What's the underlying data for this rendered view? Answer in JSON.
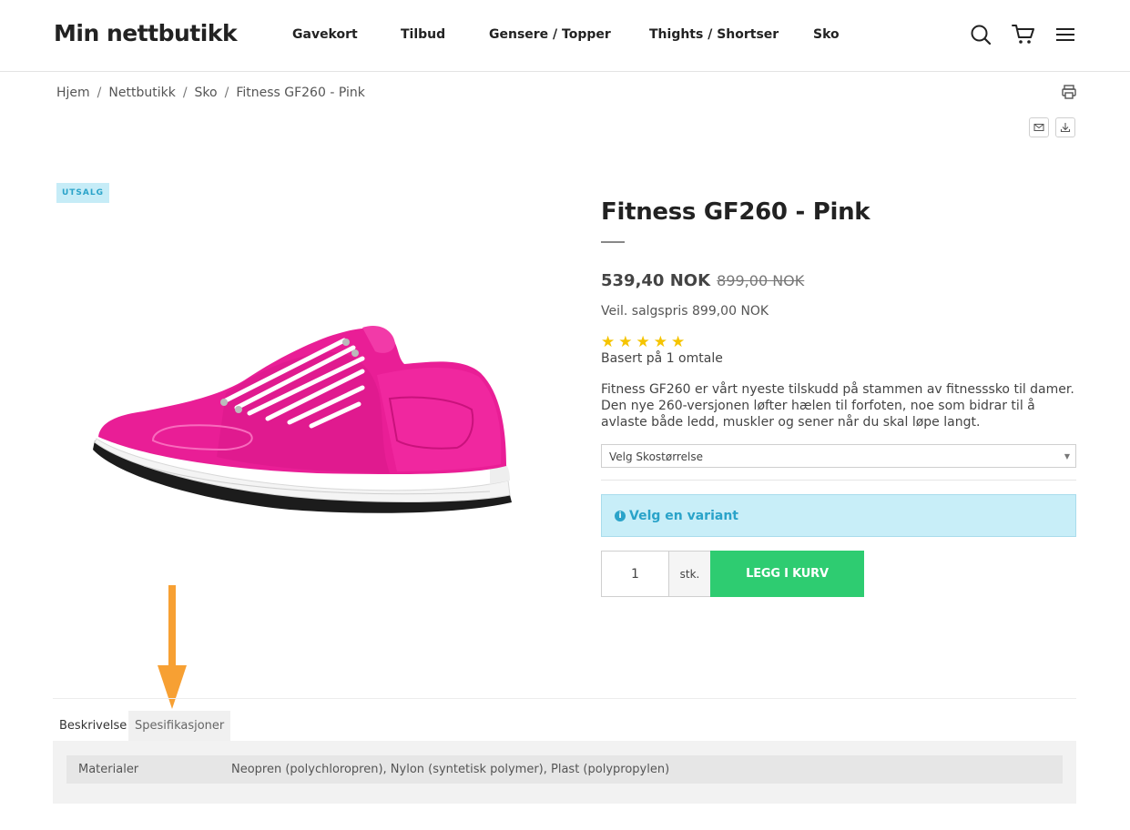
{
  "header": {
    "logo": "Min nettbutikk",
    "nav": [
      {
        "label": "Gavekort"
      },
      {
        "label": "Tilbud"
      },
      {
        "label": "Gensere / Topper"
      },
      {
        "label": "Thights / Shortser"
      },
      {
        "label": "Sko"
      }
    ],
    "icons": [
      "search-icon",
      "cart-icon",
      "menu-icon"
    ]
  },
  "breadcrumb": {
    "items": [
      "Hjem",
      "Nettbutikk",
      "Sko",
      "Fitness GF260 - Pink"
    ],
    "separator": "/"
  },
  "actions": {
    "icons": [
      "print-icon",
      "email-icon",
      "download-icon"
    ]
  },
  "product": {
    "badge": "UTSALG",
    "title": "Fitness GF260 - Pink",
    "price_now": "539,40 NOK",
    "price_old": "899,00 NOK",
    "rrp": "Veil. salgspris 899,00 NOK",
    "rating": 5,
    "stars": "★★★★★",
    "review_text": "Basert på 1 omtale",
    "description": "Fitness GF260 er vårt nyeste tilskudd på stammen av fitnesssko til damer. Den nye 260-versjonen løfter hælen til forfoten, noe som bidrar til å avlaste både ledd, muskler og sener når du skal løpe langt.",
    "size_select": "Velg Skostørrelse",
    "alert": "Velg en variant",
    "quantity": "1",
    "unit": "stk.",
    "add_to_cart": "LEGG I KURV"
  },
  "colors": {
    "accent_green": "#2ecc71",
    "info_blue": "#2aa3c9",
    "info_bg": "#c8eef8",
    "shoe_pink": "#e91e96",
    "arrow_orange": "#f7a033",
    "star_yellow": "#f5c400"
  },
  "tabs": {
    "items": [
      "Beskrivelse",
      "Spesifikasjoner"
    ],
    "active": "Spesifikasjoner"
  },
  "specs": [
    {
      "key": "Materialer",
      "value": "Neopren (polychloropren), Nylon (syntetisk polymer), Plast (polypropylen)"
    }
  ]
}
